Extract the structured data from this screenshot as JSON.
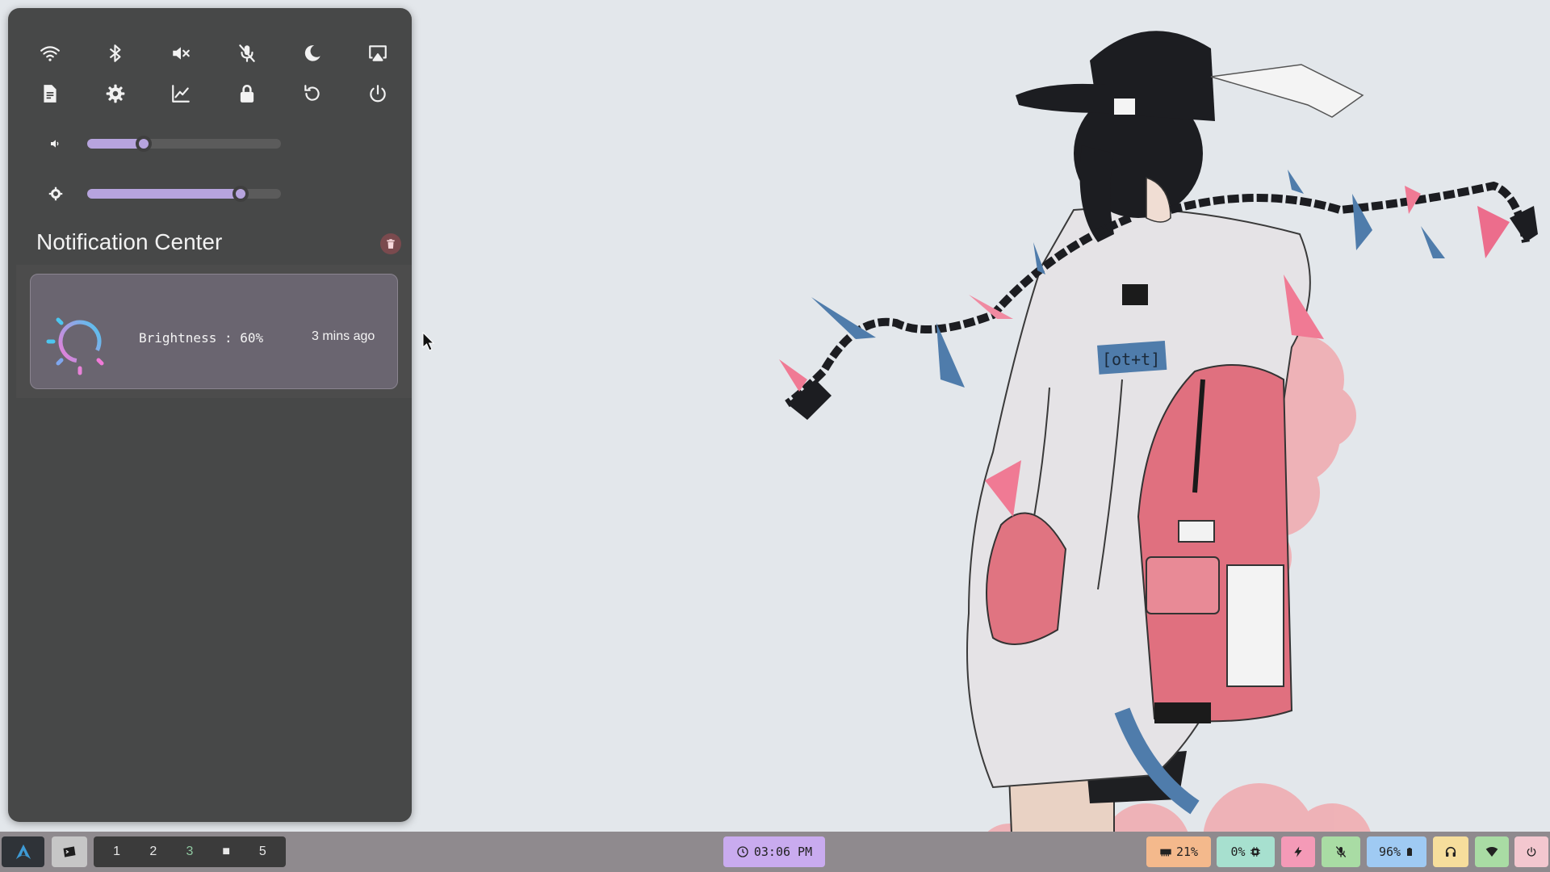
{
  "quick_settings": {
    "row1": [
      "wifi-icon",
      "bluetooth-icon",
      "volume-mute-icon",
      "mic-mute-icon",
      "night-mode-icon",
      "screencast-icon"
    ],
    "row2": [
      "notes-icon",
      "settings-icon",
      "system-monitor-icon",
      "lock-icon",
      "restart-icon",
      "power-icon"
    ]
  },
  "sliders": {
    "volume": {
      "icon": "volume-icon",
      "level": 0.29
    },
    "brightness": {
      "icon": "brightness-icon",
      "level": 0.79
    }
  },
  "notification_center": {
    "title": "Notification Center",
    "clear_icon": "trash-icon",
    "notifications": [
      {
        "icon": "brightness-gauge-icon",
        "text": "Brightness : 60%",
        "time": "3 mins ago"
      }
    ]
  },
  "taskbar": {
    "launcher_icon": "arch-logo-icon",
    "active_app_icon": "terminal-icon",
    "workspaces": [
      "1",
      "2",
      "3",
      "■",
      "5"
    ],
    "active_workspace": "3",
    "clock": {
      "icon": "clock-icon",
      "text": "03:06 PM"
    },
    "status": {
      "memory": {
        "icon": "memory-icon",
        "text": "21%",
        "color": "#f4b98c"
      },
      "cpu": {
        "icon": "cpu-icon",
        "text": "0%",
        "color": "#a7e0cf"
      },
      "power_mode": {
        "icon": "lightning-icon",
        "color": "#f49ab7"
      },
      "mic": {
        "icon": "mic-mute-icon",
        "color": "#a9dca4"
      },
      "battery": {
        "icon": "battery-icon",
        "text": "96%",
        "color": "#9fcaf3"
      },
      "headphones": {
        "icon": "headphones-icon",
        "color": "#f6de9c"
      },
      "network": {
        "icon": "wifi-signal-icon",
        "color": "#a9dca4"
      },
      "power": {
        "icon": "power-icon",
        "color": "#f3c7cf"
      }
    }
  },
  "colors": {
    "panel_bg": "#474848",
    "accent": "#b7a4de",
    "wallpaper_bg": "#e3e7eb"
  }
}
